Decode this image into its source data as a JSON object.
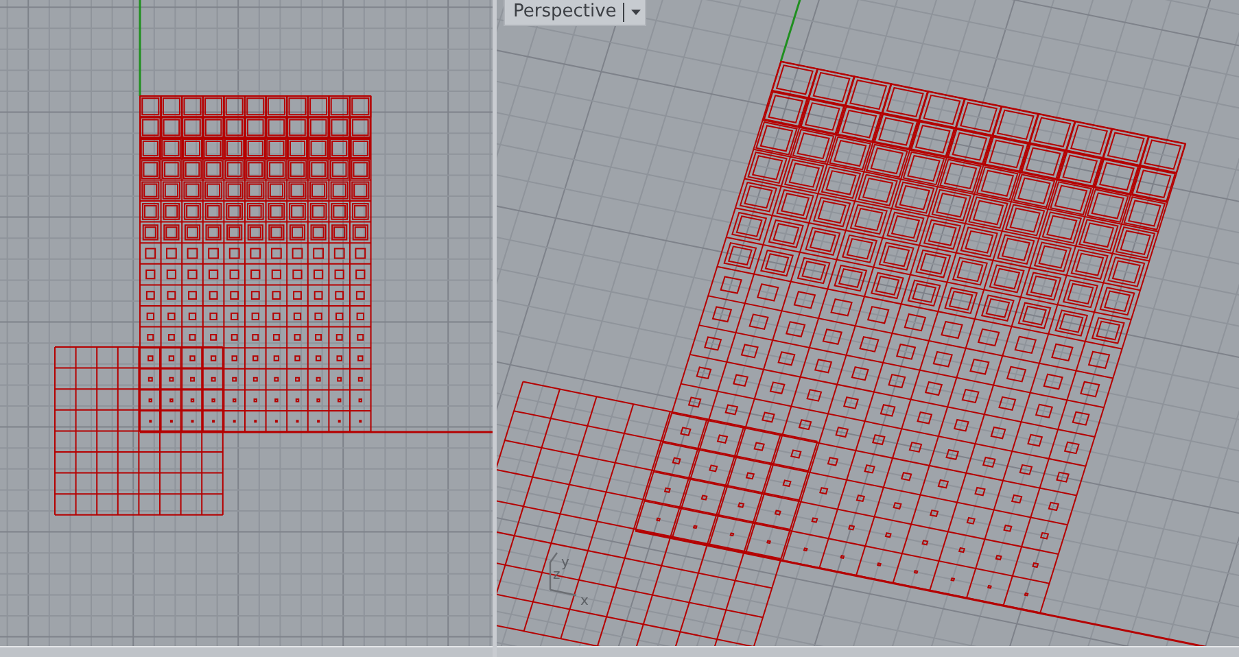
{
  "viewports": [
    {
      "kind": "top"
    },
    {
      "kind": "perspective",
      "title": "Perspective",
      "axis_labels": [
        "y",
        "z",
        "x"
      ]
    }
  ]
}
